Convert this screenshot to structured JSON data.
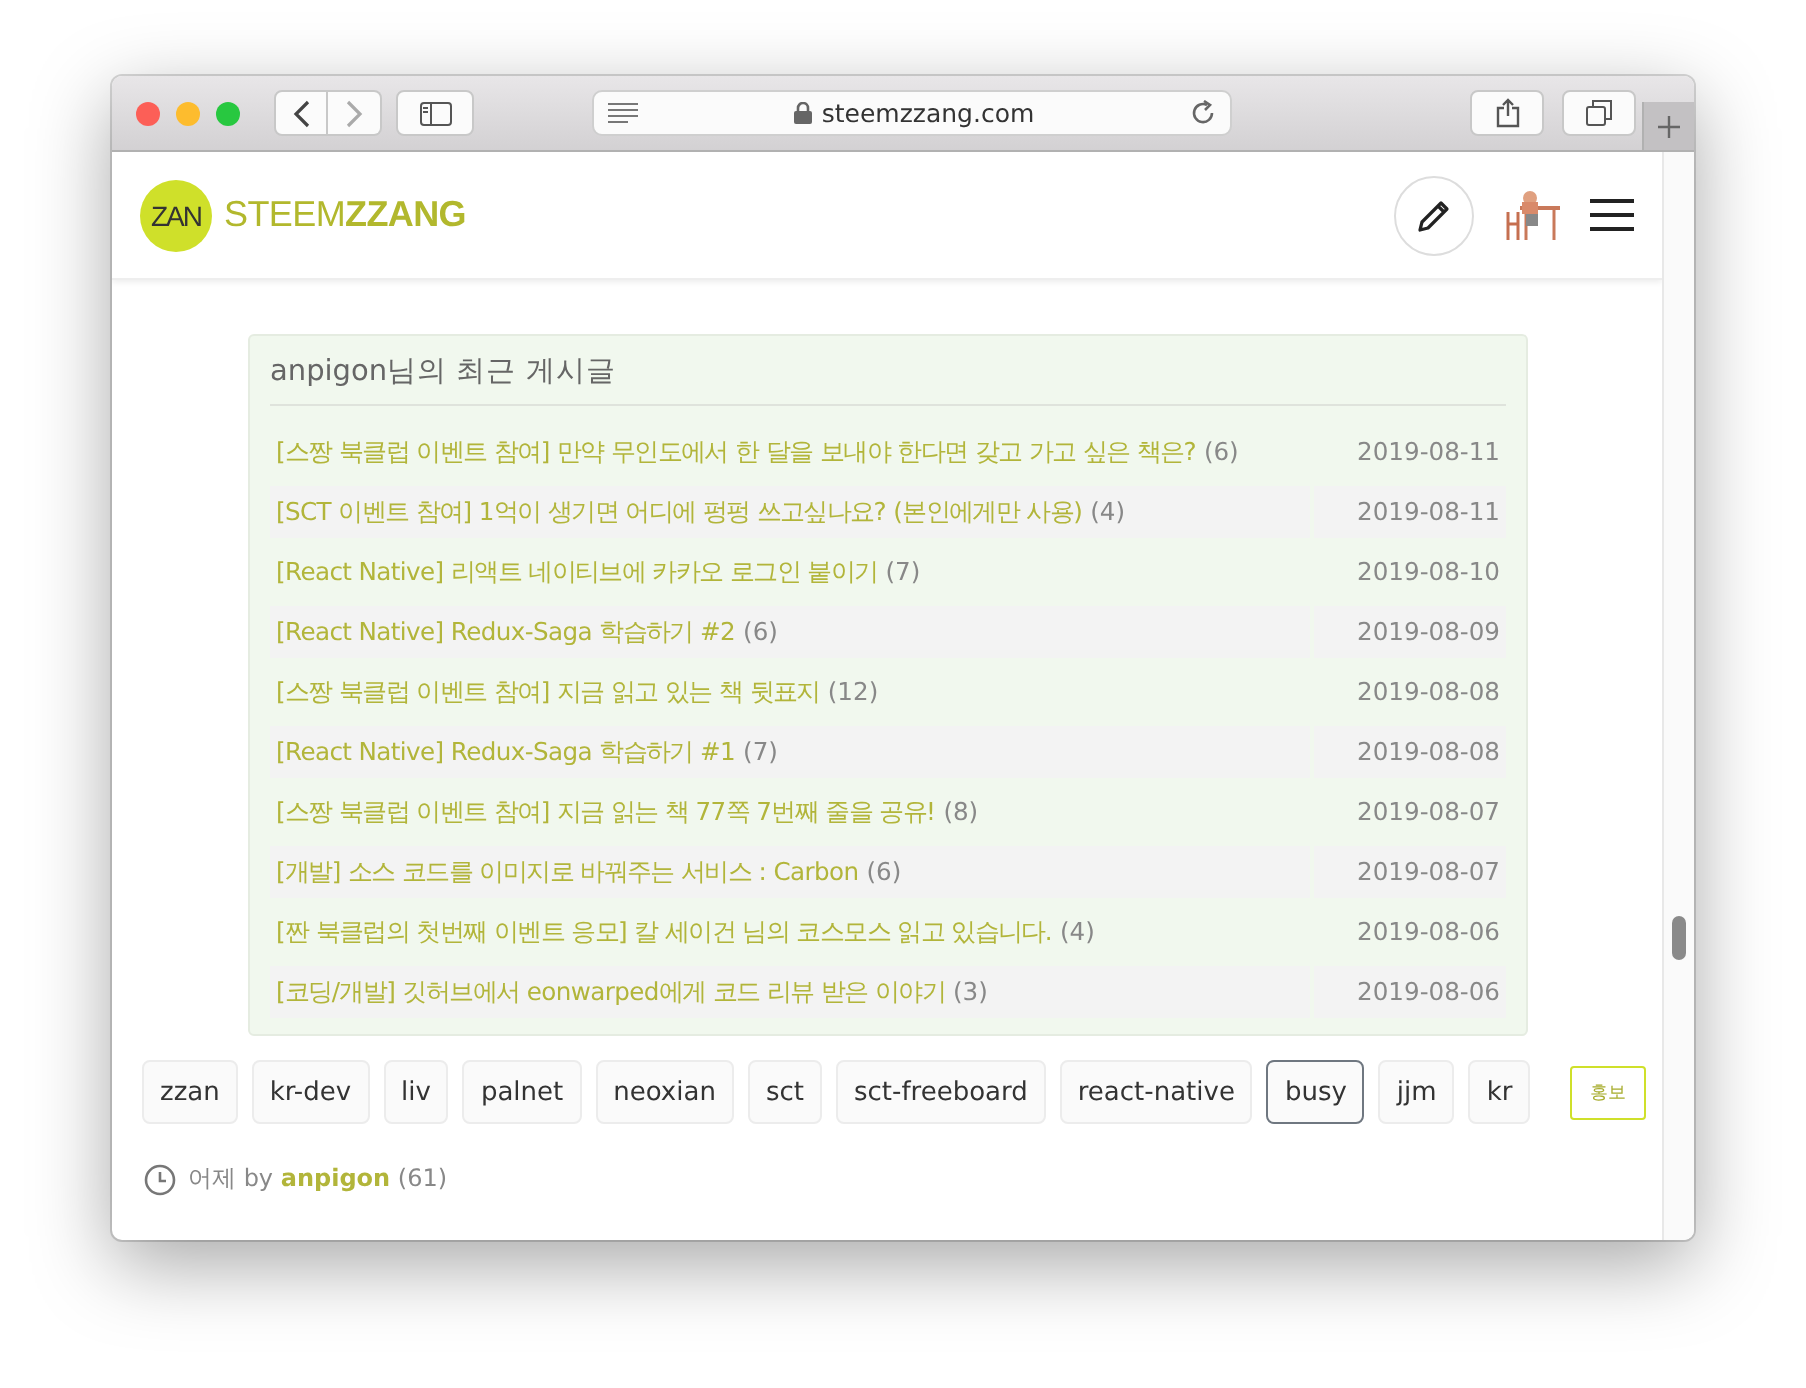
{
  "browser": {
    "address": "steemzzang.com"
  },
  "site": {
    "logo_mark": "ZAN",
    "name_light": "STEEM",
    "name_bold": "ZZANG"
  },
  "recent_posts": {
    "title": "anpigon님의 최근 게시글",
    "posts": [
      {
        "title": "[스짱 북클럽 이벤트 참여] 만약 무인도에서 한 달을 보내야 한다면 갖고 가고 싶은 책은?",
        "count": "(6)",
        "date": "2019-08-11"
      },
      {
        "title": "[SCT 이벤트 참여] 1억이 생기면 어디에 펑펑 쓰고싶나요? (본인에게만 사용)",
        "count": "(4)",
        "date": "2019-08-11"
      },
      {
        "title": "[React Native] 리액트 네이티브에 카카오 로그인 붙이기",
        "count": "(7)",
        "date": "2019-08-10"
      },
      {
        "title": "[React Native] Redux-Saga 학습하기 #2",
        "count": "(6)",
        "date": "2019-08-09"
      },
      {
        "title": "[스짱 북클럽 이벤트 참여] 지금 읽고 있는 책 뒷표지",
        "count": "(12)",
        "date": "2019-08-08"
      },
      {
        "title": "[React Native] Redux-Saga 학습하기 #1",
        "count": "(7)",
        "date": "2019-08-08"
      },
      {
        "title": "[스짱 북클럽 이벤트 참여] 지금 읽는 책 77쪽 7번째 줄을 공유!",
        "count": "(8)",
        "date": "2019-08-07"
      },
      {
        "title": "[개발] 소스 코드를 이미지로 바꿔주는 서비스 : Carbon",
        "count": "(6)",
        "date": "2019-08-07"
      },
      {
        "title": "[짠 북클럽의 첫번째 이벤트 응모] 칼 세이건 님의 코스모스 읽고 있습니다.",
        "count": "(4)",
        "date": "2019-08-06"
      },
      {
        "title": "[코딩/개발] 깃허브에서 eonwarped에게 코드 리뷰 받은 이야기",
        "count": "(3)",
        "date": "2019-08-06"
      }
    ]
  },
  "tags": [
    {
      "label": "zzan",
      "selected": false
    },
    {
      "label": "kr-dev",
      "selected": false
    },
    {
      "label": "liv",
      "selected": false
    },
    {
      "label": "palnet",
      "selected": false
    },
    {
      "label": "neoxian",
      "selected": false
    },
    {
      "label": "sct",
      "selected": false
    },
    {
      "label": "sct-freeboard",
      "selected": false
    },
    {
      "label": "react-native",
      "selected": false
    },
    {
      "label": "busy",
      "selected": true
    },
    {
      "label": "jjm",
      "selected": false
    },
    {
      "label": "kr",
      "selected": false
    }
  ],
  "promote_button": "홍보",
  "byline": {
    "time": "어제",
    "by": "by",
    "author": "anpigon",
    "reputation": "(61)"
  }
}
